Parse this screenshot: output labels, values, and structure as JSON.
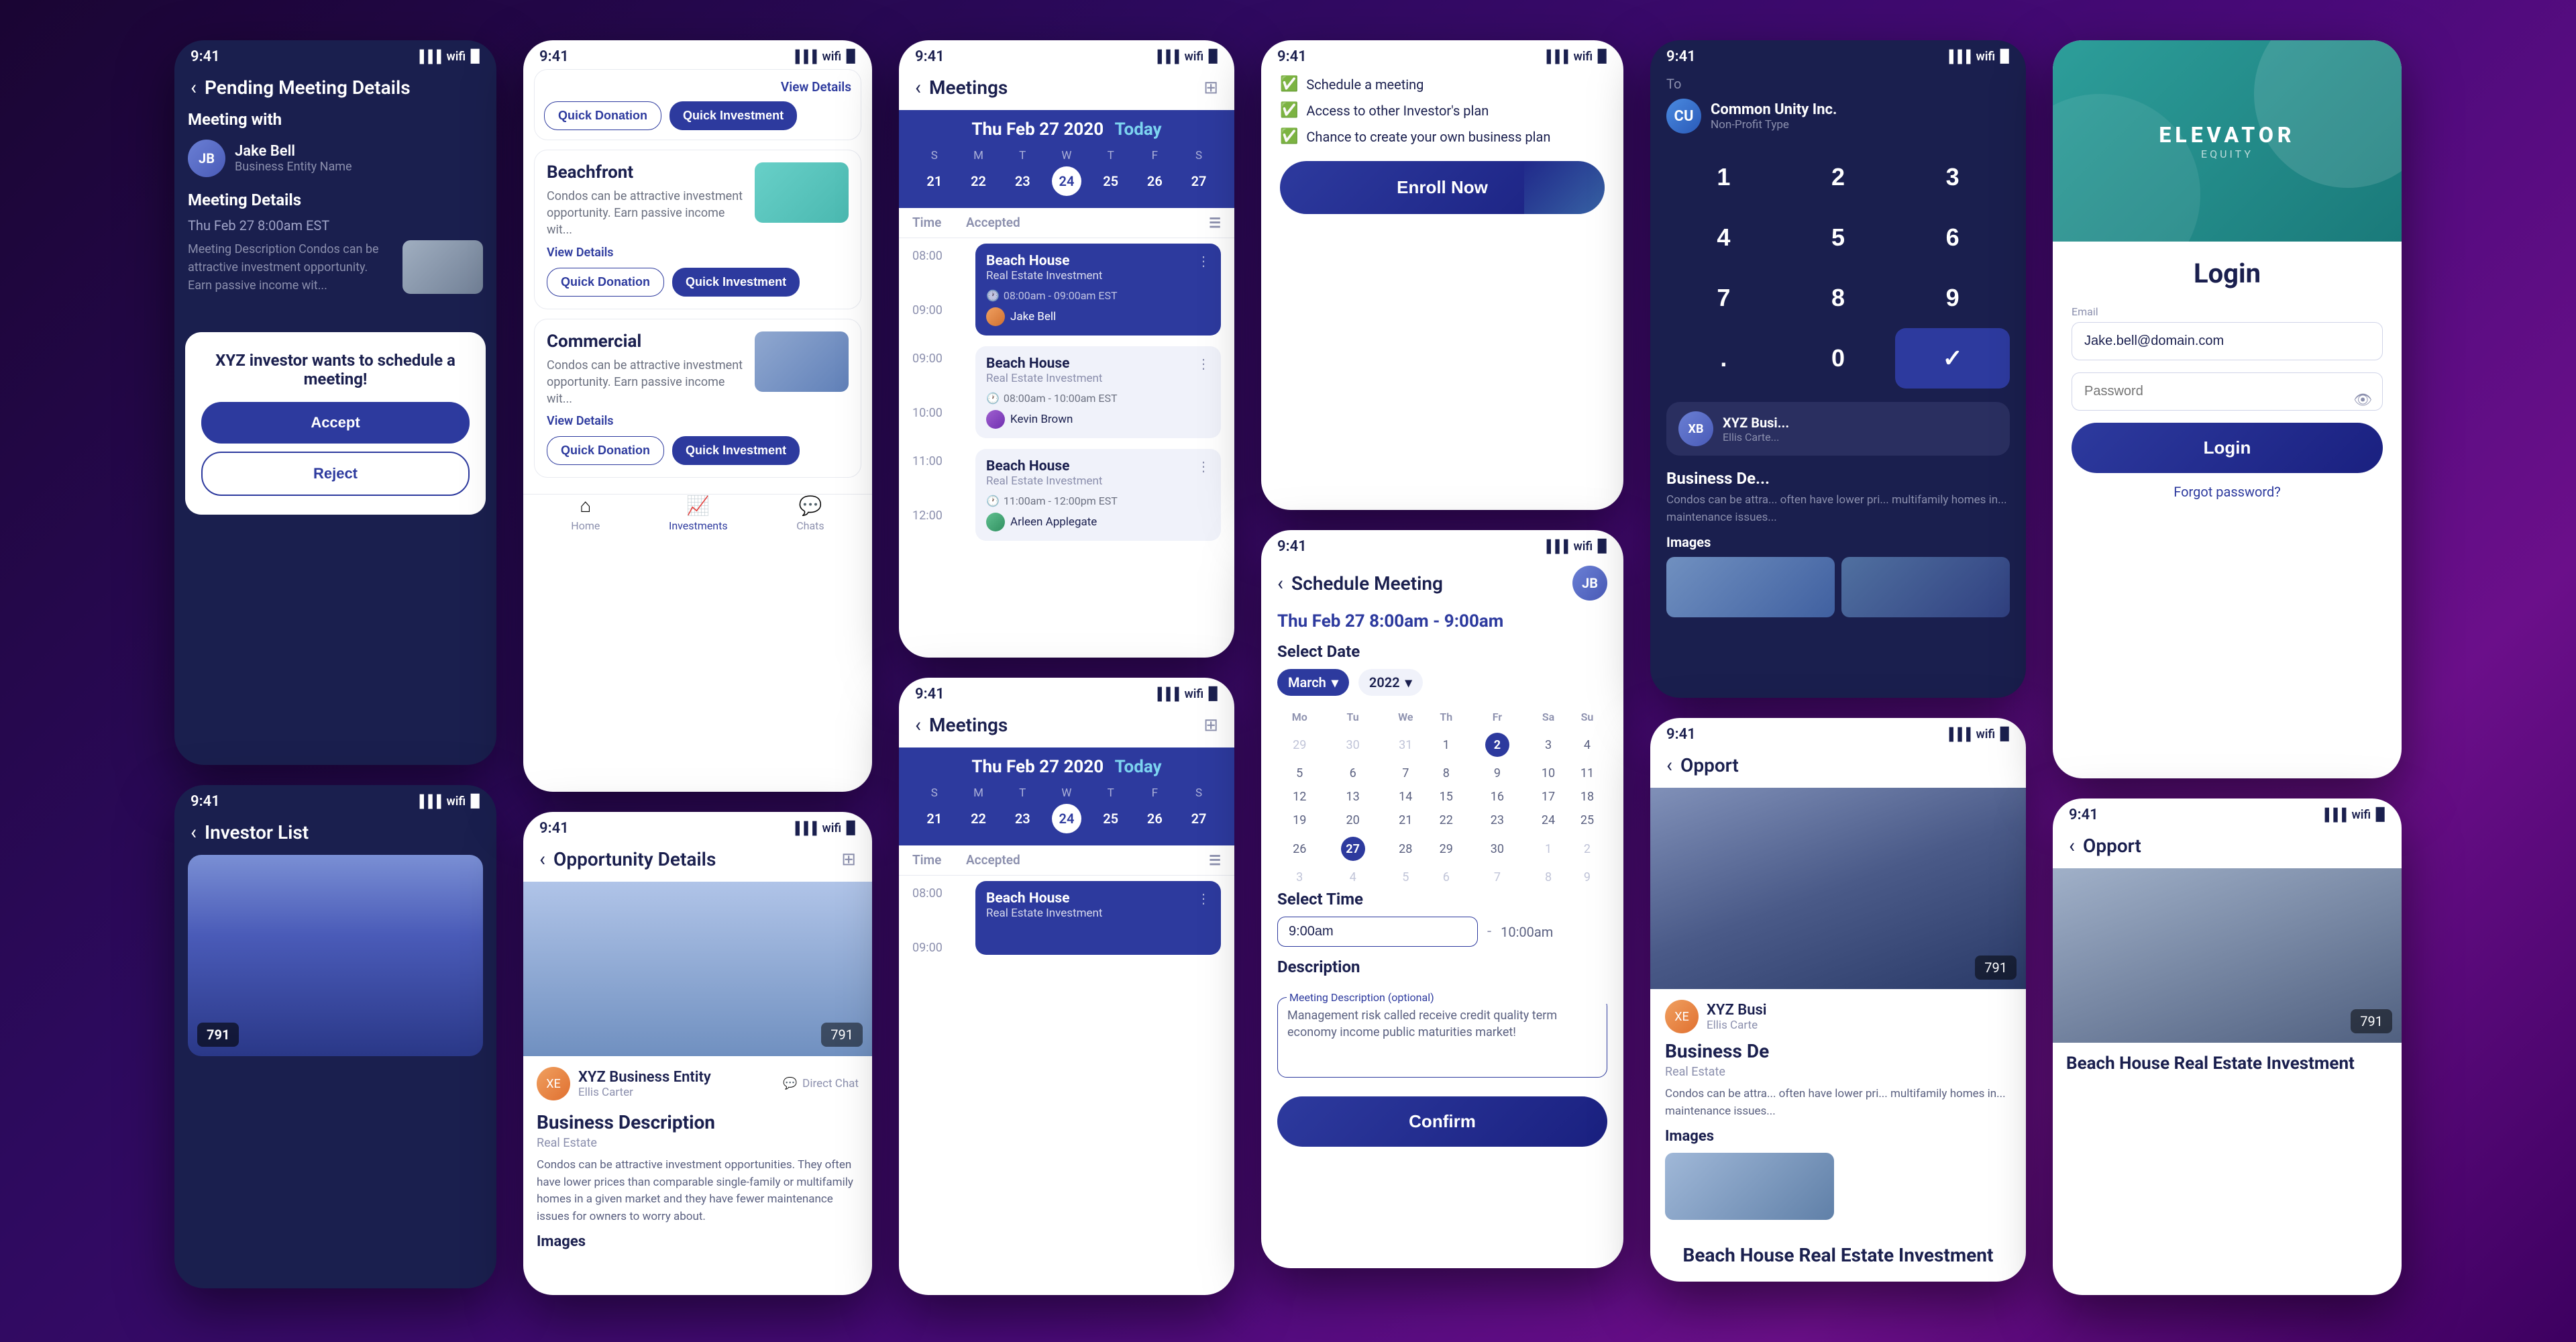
{
  "app": {
    "time": "9:41"
  },
  "phone1": {
    "meeting": {
      "header": "Pending Meeting Details",
      "meeting_with": "Meeting with",
      "person_name": "Jake Bell",
      "person_entity": "Business Entity Name",
      "details_title": "Meeting Details",
      "date": "Thu Feb 27  8:00am EST",
      "description": "Meeting Description Condos can be attractive investment opportunity. Earn passive income wit...",
      "popup_text": "XYZ investor wants to schedule a meeting!",
      "accept": "Accept",
      "reject": "Reject"
    },
    "investor_list": {
      "header": "Investor List",
      "badge": "791"
    }
  },
  "phone2": {
    "investments": {
      "card1": {
        "title": "Beachfront",
        "description": "Condos can be attractive investment opportunity. Earn passive income wit...",
        "link": "View Details",
        "btn1": "Quick Donation",
        "btn2": "Quick Investment"
      },
      "card2": {
        "title": "Commercial",
        "description": "Condos can be attractive investment opportunity. Earn passive income wit...",
        "link": "View Details",
        "btn1": "Quick Donation",
        "btn2": "Quick Investment"
      },
      "nav": {
        "home": "Home",
        "investments": "Investments",
        "chats": "Chats"
      }
    },
    "opportunity": {
      "header": "Opportunity Details",
      "badge": "791",
      "person_name": "XYZ Business Entity",
      "person_sub": "Ellis Carter",
      "direct_chat": "Direct Chat",
      "title": "Business Description",
      "type": "Real Estate",
      "description": "Condos can be attractive investment opportunities. They often have lower prices than comparable single-family or multifamily homes in a given market and they have fewer maintenance issues for owners to worry about.",
      "images": "Images"
    }
  },
  "phone3": {
    "meetings1": {
      "header": "Meetings",
      "date_label": "Thu Feb 27 2020",
      "today": "Today",
      "week_days": [
        "S",
        "M",
        "T",
        "W",
        "T",
        "F",
        "S"
      ],
      "week_nums": [
        "21",
        "22",
        "23",
        "24",
        "25",
        "26",
        "27"
      ],
      "active_day": "24",
      "col_time": "Time",
      "col_accepted": "Accepted",
      "slots": [
        {
          "time": "08:00",
          "time2": "09:00",
          "card_title": "Beach House",
          "card_sub": "Real Estate Investment",
          "card_time": "08:00am - 09:00am EST",
          "card_person": "Jake Bell",
          "card_type": "blue"
        },
        {
          "time": "09:00",
          "time2": "10:00",
          "card_title": "Beach House",
          "card_sub": "Real Estate Investment",
          "card_time": "08:00am - 10:00am EST",
          "card_person": "Kevin Brown",
          "card_type": "gray"
        },
        {
          "time": "11:00",
          "time2": "12:00",
          "card_title": "Beach House",
          "card_sub": "Real Estate Investment",
          "card_time": "11:00am - 12:00pm EST",
          "card_person": "Arleen Applegate",
          "card_type": "gray"
        }
      ]
    },
    "meetings2": {
      "header": "Meetings",
      "date_label": "Thu Feb 27 2020",
      "today": "Today",
      "week_days": [
        "S",
        "M",
        "T",
        "W",
        "T",
        "F",
        "S"
      ],
      "week_nums": [
        "21",
        "22",
        "23",
        "24",
        "25",
        "26",
        "27"
      ],
      "active_day": "24",
      "col_time": "Time",
      "col_accepted": "Accepted",
      "slots": [
        {
          "time": "08:00",
          "time2": "09:00",
          "card_title": "Beach House",
          "card_sub": "Real Estate Investment",
          "card_type": "blue"
        }
      ]
    }
  },
  "phone4": {
    "enroll": {
      "checks": [
        "Schedule a meeting",
        "Access to other Investor's plan",
        "Chance to create your own business plan"
      ],
      "btn_label": "Enroll Now"
    },
    "schedule": {
      "header": "Schedule Meeting",
      "date_label": "Thu Feb 27  8:00am - 9:00am",
      "select_date": "Select Date",
      "month": "March",
      "year": "2022",
      "week_headers": [
        "Mo",
        "Tu",
        "We",
        "Th",
        "Fr",
        "Sa",
        "Su"
      ],
      "weeks": [
        [
          "29",
          "30",
          "31",
          "1",
          "2",
          "3",
          "4"
        ],
        [
          "5",
          "6",
          "7",
          "8",
          "9",
          "10",
          "11"
        ],
        [
          "12",
          "13",
          "14",
          "15",
          "16",
          "17",
          "18"
        ],
        [
          "19",
          "20",
          "21",
          "22",
          "23",
          "24",
          "25"
        ],
        [
          "26",
          "27",
          "28",
          "29",
          "30",
          "1",
          "2"
        ],
        [
          "3",
          "4",
          "5",
          "6",
          "7",
          "8",
          "9"
        ]
      ],
      "active_day": "27",
      "select_time": "Select Time",
      "time_start": "9:00am",
      "time_end": "10:00am",
      "description": "Description",
      "desc_label": "Meeting Description (optional)",
      "desc_value": "Management risk called receive credit quality term economy income public maturities market!",
      "confirm_btn": "Confirm"
    }
  },
  "phone5": {
    "numpad": {
      "to_label": "To",
      "entity_name": "Common Unity Inc.",
      "entity_type": "Non-Profit Type",
      "keys": [
        "1",
        "2",
        "3",
        "4",
        "5",
        "6",
        "7",
        "8",
        "9",
        ".",
        "0",
        "✓"
      ]
    },
    "biz": {
      "header": "Opport",
      "badge": "791",
      "person_name": "XYZ Busi",
      "person_sub": "Ellis Carte",
      "title": "Business De",
      "type": "Real Estate",
      "description": "Condos can be attra... often have lower pri... multifamily homes in... maintenance issues...",
      "images": "Images"
    }
  },
  "phone6": {
    "login": {
      "logo": "ELEVATOR",
      "logo_sub": "EQUITY",
      "title": "Login",
      "email_label": "Email",
      "email_value": "Jake.bell@domain.com",
      "password_label": "Password",
      "password_placeholder": "Password",
      "btn_login": "Login",
      "forgot": "Forgot password?"
    },
    "opp": {
      "header": "Opport",
      "badge": "791",
      "title": "Beach House Real Estate Investment"
    }
  }
}
